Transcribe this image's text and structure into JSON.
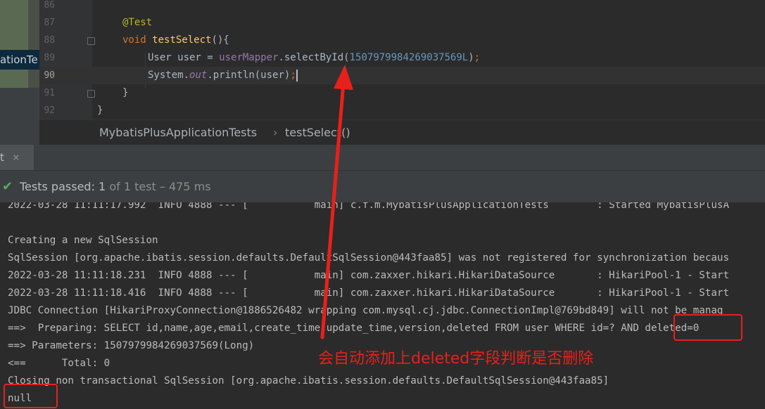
{
  "project_panel": {
    "label": "ationTe"
  },
  "editor": {
    "lines": [
      {
        "number": "86"
      },
      {
        "number": "87"
      },
      {
        "number": "88"
      },
      {
        "number": "89"
      },
      {
        "number": "90"
      },
      {
        "number": "91"
      },
      {
        "number": "92"
      }
    ],
    "code": {
      "annotation": "@Test",
      "void_kw": "void",
      "method_name": "testSelect",
      "method_sig_rest": "(){",
      "user_decl": "User user = ",
      "user_mapper": "userMapper",
      "select_call": ".selectById(",
      "id_literal": "1507979984269037569L",
      "close_paren": ")",
      "semicolon": ";",
      "system": "System.",
      "out": "out",
      "println": ".println(user)",
      "close_brace_inner": "}",
      "close_brace_outer": "}"
    }
  },
  "breadcrumb": {
    "class_name": "MybatisPlusApplicationTests",
    "separator": "›",
    "method_name": "testSelect()"
  },
  "run_panel": {
    "tab_label": "t",
    "close_glyph": "×",
    "status_passed": "Tests passed: ",
    "status_count": "1",
    "status_detail": " of 1 test – 475 ms"
  },
  "console_lines": [
    "2022-03-28 11:11:17.992  INFO 4888 --- [           main] c.f.m.MybatisPlusApplicationTests        : Started MybatisPlusA",
    "",
    "Creating a new SqlSession",
    "SqlSession [org.apache.ibatis.session.defaults.DefaultSqlSession@443faa85] was not registered for synchronization becaus",
    "2022-03-28 11:11:18.231  INFO 4888 --- [           main] com.zaxxer.hikari.HikariDataSource       : HikariPool-1 - Start",
    "2022-03-28 11:11:18.416  INFO 4888 --- [           main] com.zaxxer.hikari.HikariDataSource       : HikariPool-1 - Start",
    "JDBC Connection [HikariProxyConnection@1886526482 wrapping com.mysql.cj.jdbc.ConnectionImpl@769bd849] will not be manag",
    "==>  Preparing: SELECT id,name,age,email,create_time,update_time,version,deleted FROM user WHERE id=? AND deleted=0",
    "==> Parameters: 1507979984269037569(Long)",
    "<==      Total: 0",
    "Closing non transactional SqlSession [org.apache.ibatis.session.defaults.DefaultSqlSession@443faa85]",
    "null"
  ],
  "annotation": {
    "text": "会自动添加上deleted字段判断是否删除",
    "color": "#e8201b"
  },
  "colors": {
    "pass": "#59a869",
    "keyword": "#cc7832",
    "annotation": "#bbb529",
    "method": "#ffc66d",
    "field": "#9876aa",
    "number": "#6897bb"
  }
}
